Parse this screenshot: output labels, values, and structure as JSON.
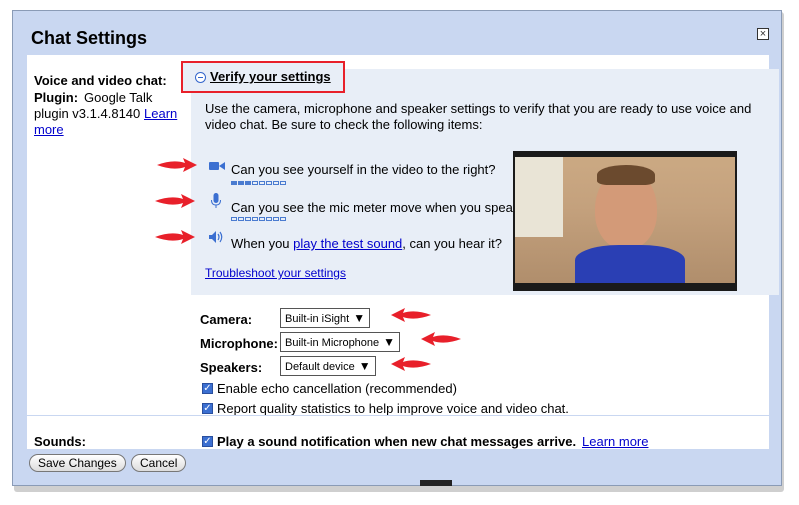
{
  "dialog": {
    "title": "Chat Settings",
    "close_glyph": "×"
  },
  "voice": {
    "label": "Voice and video chat:",
    "plugin_label": "Plugin:",
    "plugin_text_1": "Google Talk",
    "plugin_text_2": "plugin v3.1.4.8140",
    "learn_more": "Learn",
    "learn_more_2": "more"
  },
  "verify": {
    "header": "Verify your settings",
    "intro_1": "Use the camera, microphone and speaker settings to verify that you are ready to use voice and",
    "intro_2": "video chat. Be sure to check the following items:",
    "item_camera": "Can you see yourself in the video to the right?",
    "item_mic": "Can you see the mic meter move when you speak?",
    "item_sound_pre": "When you ",
    "item_sound_link": "play the test sound",
    "item_sound_post": ", can you hear it?",
    "troubleshoot": "Troubleshoot your settings",
    "mic_meter_level": 0.375,
    "speaker_meter_level": 0
  },
  "devices": {
    "camera_label": "Camera:",
    "camera_value": "Built-in iSight",
    "mic_label": "Microphone:",
    "mic_value": "Built-in Microphone",
    "speakers_label": "Speakers:",
    "speakers_value": "Default device",
    "dropdown_glyph": "▼"
  },
  "options": {
    "echo": "Enable echo cancellation (recommended)",
    "quality": "Report quality statistics to help improve voice and video chat."
  },
  "sounds": {
    "label": "Sounds:",
    "text": "Play a sound notification when new chat messages arrive.",
    "learn_more": "Learn more"
  },
  "buttons": {
    "save": "Save Changes",
    "cancel": "Cancel"
  },
  "colors": {
    "accent_red": "#e8202a",
    "link_blue": "#0000cc",
    "frame_blue": "#c9d7f1"
  }
}
